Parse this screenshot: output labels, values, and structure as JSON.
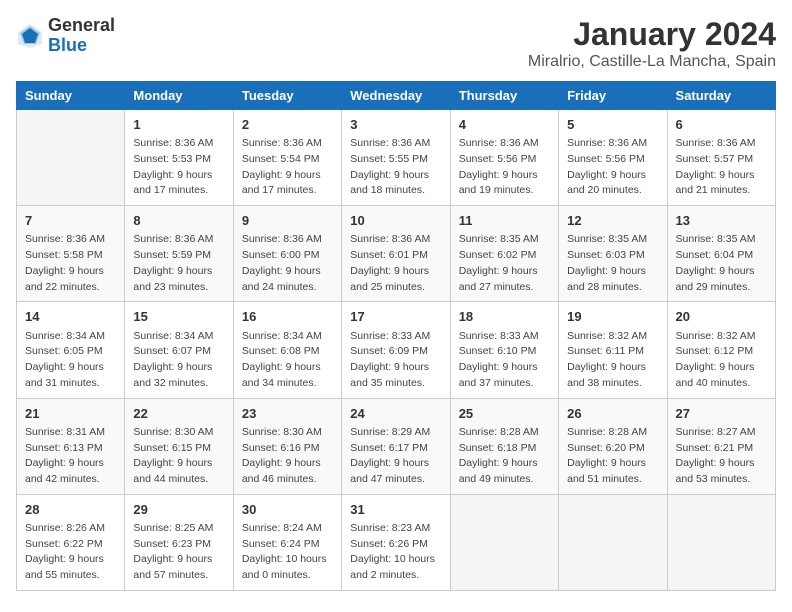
{
  "logo": {
    "general": "General",
    "blue": "Blue"
  },
  "title": "January 2024",
  "subtitle": "Miralrio, Castille-La Mancha, Spain",
  "calendar": {
    "headers": [
      "Sunday",
      "Monday",
      "Tuesday",
      "Wednesday",
      "Thursday",
      "Friday",
      "Saturday"
    ],
    "weeks": [
      [
        {
          "day": "",
          "info": ""
        },
        {
          "day": "1",
          "info": "Sunrise: 8:36 AM\nSunset: 5:53 PM\nDaylight: 9 hours\nand 17 minutes."
        },
        {
          "day": "2",
          "info": "Sunrise: 8:36 AM\nSunset: 5:54 PM\nDaylight: 9 hours\nand 17 minutes."
        },
        {
          "day": "3",
          "info": "Sunrise: 8:36 AM\nSunset: 5:55 PM\nDaylight: 9 hours\nand 18 minutes."
        },
        {
          "day": "4",
          "info": "Sunrise: 8:36 AM\nSunset: 5:56 PM\nDaylight: 9 hours\nand 19 minutes."
        },
        {
          "day": "5",
          "info": "Sunrise: 8:36 AM\nSunset: 5:56 PM\nDaylight: 9 hours\nand 20 minutes."
        },
        {
          "day": "6",
          "info": "Sunrise: 8:36 AM\nSunset: 5:57 PM\nDaylight: 9 hours\nand 21 minutes."
        }
      ],
      [
        {
          "day": "7",
          "info": "Sunrise: 8:36 AM\nSunset: 5:58 PM\nDaylight: 9 hours\nand 22 minutes."
        },
        {
          "day": "8",
          "info": "Sunrise: 8:36 AM\nSunset: 5:59 PM\nDaylight: 9 hours\nand 23 minutes."
        },
        {
          "day": "9",
          "info": "Sunrise: 8:36 AM\nSunset: 6:00 PM\nDaylight: 9 hours\nand 24 minutes."
        },
        {
          "day": "10",
          "info": "Sunrise: 8:36 AM\nSunset: 6:01 PM\nDaylight: 9 hours\nand 25 minutes."
        },
        {
          "day": "11",
          "info": "Sunrise: 8:35 AM\nSunset: 6:02 PM\nDaylight: 9 hours\nand 27 minutes."
        },
        {
          "day": "12",
          "info": "Sunrise: 8:35 AM\nSunset: 6:03 PM\nDaylight: 9 hours\nand 28 minutes."
        },
        {
          "day": "13",
          "info": "Sunrise: 8:35 AM\nSunset: 6:04 PM\nDaylight: 9 hours\nand 29 minutes."
        }
      ],
      [
        {
          "day": "14",
          "info": "Sunrise: 8:34 AM\nSunset: 6:05 PM\nDaylight: 9 hours\nand 31 minutes."
        },
        {
          "day": "15",
          "info": "Sunrise: 8:34 AM\nSunset: 6:07 PM\nDaylight: 9 hours\nand 32 minutes."
        },
        {
          "day": "16",
          "info": "Sunrise: 8:34 AM\nSunset: 6:08 PM\nDaylight: 9 hours\nand 34 minutes."
        },
        {
          "day": "17",
          "info": "Sunrise: 8:33 AM\nSunset: 6:09 PM\nDaylight: 9 hours\nand 35 minutes."
        },
        {
          "day": "18",
          "info": "Sunrise: 8:33 AM\nSunset: 6:10 PM\nDaylight: 9 hours\nand 37 minutes."
        },
        {
          "day": "19",
          "info": "Sunrise: 8:32 AM\nSunset: 6:11 PM\nDaylight: 9 hours\nand 38 minutes."
        },
        {
          "day": "20",
          "info": "Sunrise: 8:32 AM\nSunset: 6:12 PM\nDaylight: 9 hours\nand 40 minutes."
        }
      ],
      [
        {
          "day": "21",
          "info": "Sunrise: 8:31 AM\nSunset: 6:13 PM\nDaylight: 9 hours\nand 42 minutes."
        },
        {
          "day": "22",
          "info": "Sunrise: 8:30 AM\nSunset: 6:15 PM\nDaylight: 9 hours\nand 44 minutes."
        },
        {
          "day": "23",
          "info": "Sunrise: 8:30 AM\nSunset: 6:16 PM\nDaylight: 9 hours\nand 46 minutes."
        },
        {
          "day": "24",
          "info": "Sunrise: 8:29 AM\nSunset: 6:17 PM\nDaylight: 9 hours\nand 47 minutes."
        },
        {
          "day": "25",
          "info": "Sunrise: 8:28 AM\nSunset: 6:18 PM\nDaylight: 9 hours\nand 49 minutes."
        },
        {
          "day": "26",
          "info": "Sunrise: 8:28 AM\nSunset: 6:20 PM\nDaylight: 9 hours\nand 51 minutes."
        },
        {
          "day": "27",
          "info": "Sunrise: 8:27 AM\nSunset: 6:21 PM\nDaylight: 9 hours\nand 53 minutes."
        }
      ],
      [
        {
          "day": "28",
          "info": "Sunrise: 8:26 AM\nSunset: 6:22 PM\nDaylight: 9 hours\nand 55 minutes."
        },
        {
          "day": "29",
          "info": "Sunrise: 8:25 AM\nSunset: 6:23 PM\nDaylight: 9 hours\nand 57 minutes."
        },
        {
          "day": "30",
          "info": "Sunrise: 8:24 AM\nSunset: 6:24 PM\nDaylight: 10 hours\nand 0 minutes."
        },
        {
          "day": "31",
          "info": "Sunrise: 8:23 AM\nSunset: 6:26 PM\nDaylight: 10 hours\nand 2 minutes."
        },
        {
          "day": "",
          "info": ""
        },
        {
          "day": "",
          "info": ""
        },
        {
          "day": "",
          "info": ""
        }
      ]
    ]
  }
}
